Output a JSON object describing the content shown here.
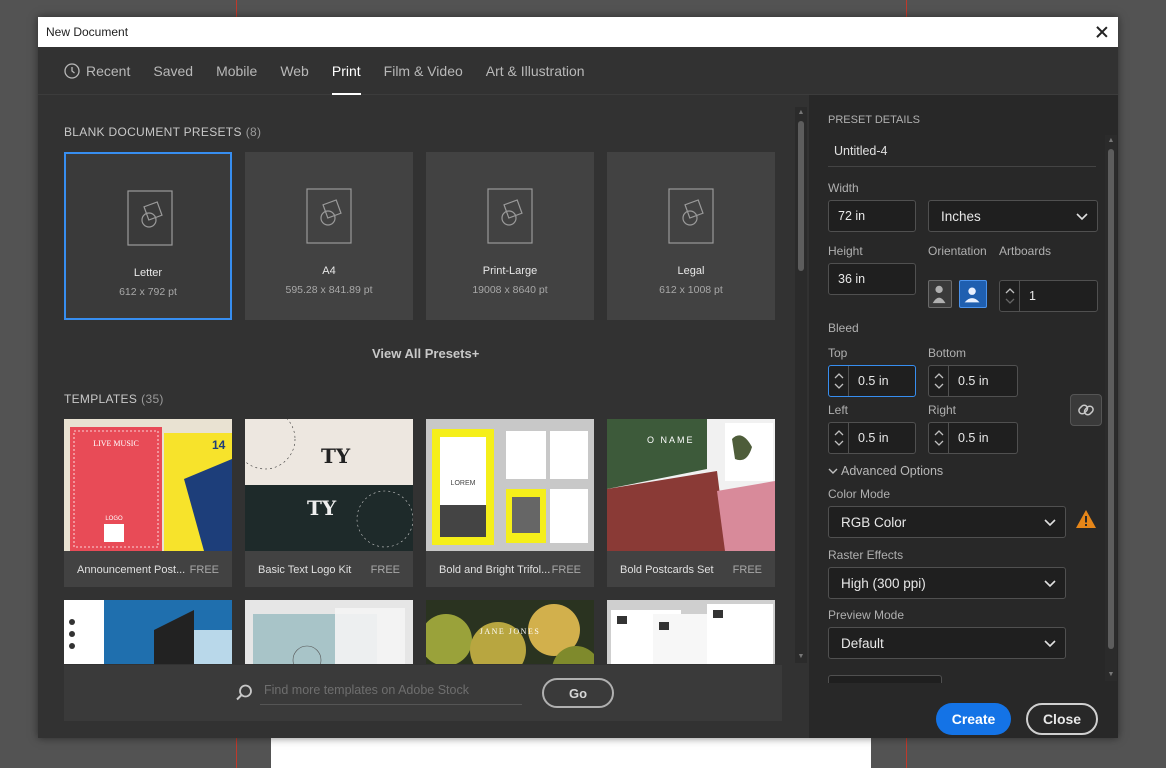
{
  "dialog": {
    "title": "New Document"
  },
  "tabs": [
    {
      "label": "Recent"
    },
    {
      "label": "Saved"
    },
    {
      "label": "Mobile"
    },
    {
      "label": "Web"
    },
    {
      "label": "Print",
      "active": true
    },
    {
      "label": "Film & Video"
    },
    {
      "label": "Art & Illustration"
    }
  ],
  "presets": {
    "title": "BLANK DOCUMENT PRESETS",
    "count": "(8)",
    "items": [
      {
        "name": "Letter",
        "size": "612 x 792 pt",
        "selected": true
      },
      {
        "name": "A4",
        "size": "595.28 x 841.89 pt"
      },
      {
        "name": "Print-Large",
        "size": "19008 x 8640 pt"
      },
      {
        "name": "Legal",
        "size": "612 x 1008 pt"
      }
    ],
    "view_all": "View All Presets+"
  },
  "templates": {
    "title": "TEMPLATES",
    "count": "(35)",
    "items": [
      {
        "name": "Announcement Post...",
        "price": "FREE",
        "thumb_text": [
          "LIVE MUSIC",
          "14",
          "LOGO"
        ]
      },
      {
        "name": "Basic Text Logo Kit",
        "price": "FREE",
        "thumb_text": [
          "TY",
          "TY"
        ]
      },
      {
        "name": "Bold and Bright Trifol...",
        "price": "FREE",
        "thumb_text": [
          "LOREM"
        ]
      },
      {
        "name": "Bold Postcards Set",
        "price": "FREE",
        "thumb_text": [
          "O NAME"
        ]
      },
      {
        "name": "",
        "price": "",
        "thumb_text": []
      },
      {
        "name": "",
        "price": "",
        "thumb_text": []
      },
      {
        "name": "",
        "price": "",
        "thumb_text": [
          "JANE JONES"
        ]
      },
      {
        "name": "",
        "price": "",
        "thumb_text": []
      }
    ]
  },
  "search": {
    "placeholder": "Find more templates on Adobe Stock",
    "go_label": "Go"
  },
  "details": {
    "title": "PRESET DETAILS",
    "name": "Untitled-4",
    "width_label": "Width",
    "width_value": "72 in",
    "units": "Inches",
    "height_label": "Height",
    "height_value": "36 in",
    "orientation_label": "Orientation",
    "artboards_label": "Artboards",
    "artboards_value": "1",
    "bleed_label": "Bleed",
    "top_label": "Top",
    "top_value": "0.5 in",
    "bottom_label": "Bottom",
    "bottom_value": "0.5 in",
    "left_label": "Left",
    "left_value": "0.5 in",
    "right_label": "Right",
    "right_value": "0.5 in",
    "advanced_label": "Advanced Options",
    "color_mode_label": "Color Mode",
    "color_mode_value": "RGB Color",
    "raster_label": "Raster Effects",
    "raster_value": "High (300 ppi)",
    "preview_label": "Preview Mode",
    "preview_value": "Default"
  },
  "actions": {
    "create": "Create",
    "close": "Close"
  },
  "colors": {
    "accent": "#1473e6",
    "selection": "#378ef0",
    "warning": "#e68619"
  }
}
